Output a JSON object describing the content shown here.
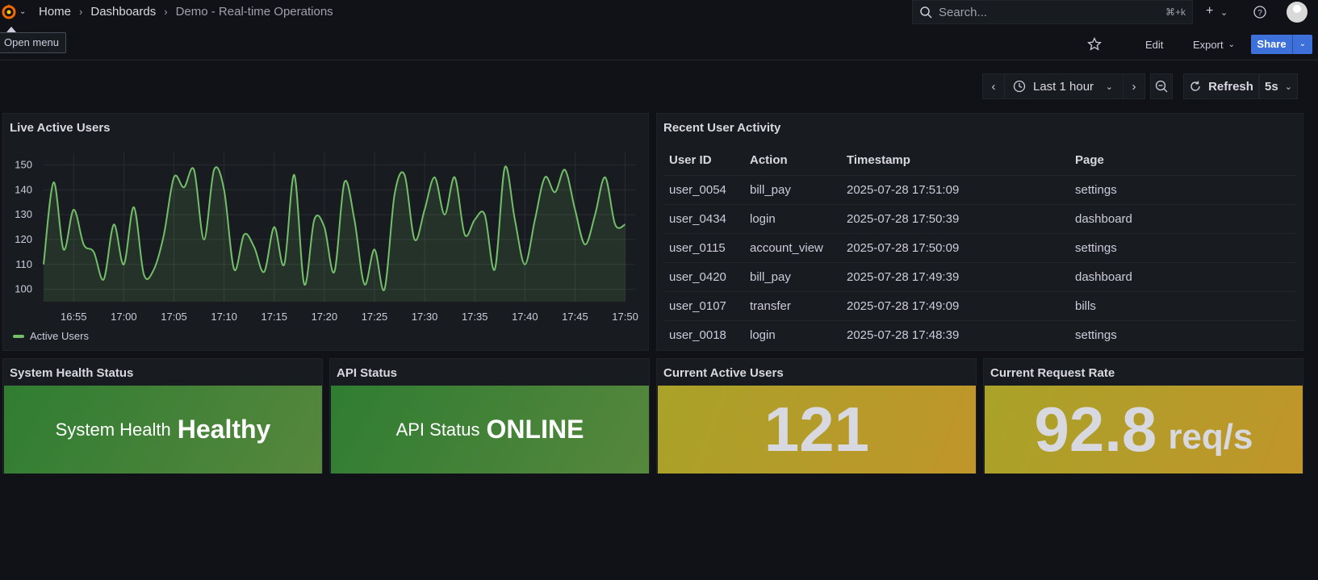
{
  "topbar": {
    "breadcrumbs": [
      "Home",
      "Dashboards",
      "Demo - Real-time Operations"
    ],
    "search_placeholder": "Search...",
    "search_shortcut": "⌘+k",
    "tooltip": "Open menu"
  },
  "toolbar": {
    "edit_label": "Edit",
    "export_label": "Export",
    "share_label": "Share"
  },
  "timepicker": {
    "range_label": "Last 1 hour",
    "refresh_label": "Refresh",
    "interval_label": "5s"
  },
  "panels": {
    "live_users": {
      "title": "Live Active Users",
      "legend": "Active Users"
    },
    "activity": {
      "title": "Recent User Activity",
      "columns": [
        "User ID",
        "Action",
        "Timestamp",
        "Page"
      ],
      "rows": [
        [
          "user_0054",
          "bill_pay",
          "2025-07-28 17:51:09",
          "settings"
        ],
        [
          "user_0434",
          "login",
          "2025-07-28 17:50:39",
          "dashboard"
        ],
        [
          "user_0115",
          "account_view",
          "2025-07-28 17:50:09",
          "settings"
        ],
        [
          "user_0420",
          "bill_pay",
          "2025-07-28 17:49:39",
          "dashboard"
        ],
        [
          "user_0107",
          "transfer",
          "2025-07-28 17:49:09",
          "bills"
        ],
        [
          "user_0018",
          "login",
          "2025-07-28 17:48:39",
          "settings"
        ]
      ]
    },
    "system_health": {
      "title": "System Health Status",
      "label": "System Health",
      "value": "Healthy"
    },
    "api_status": {
      "title": "API Status",
      "label": "API Status",
      "value": "ONLINE"
    },
    "current_users": {
      "title": "Current Active Users",
      "value": "121"
    },
    "request_rate": {
      "title": "Current Request Rate",
      "value": "92.8",
      "unit": "req/s"
    }
  },
  "colors": {
    "series": "#73bf69",
    "green_panel": "#3f8f3a",
    "yellow_panel": "#b8a32a",
    "share": "#3d71d9"
  },
  "chart_data": {
    "type": "line",
    "title": "Live Active Users",
    "x_ticks": [
      "16:55",
      "17:00",
      "17:05",
      "17:10",
      "17:15",
      "17:20",
      "17:25",
      "17:30",
      "17:35",
      "17:40",
      "17:45",
      "17:50"
    ],
    "y_ticks": [
      100,
      110,
      120,
      130,
      140,
      150
    ],
    "ylim": [
      95,
      155
    ],
    "xlim_minutes": [
      -58,
      1
    ],
    "series": [
      {
        "name": "Active Users",
        "x_minutes": [
          -58,
          -57,
          -56,
          -55,
          -54,
          -53,
          -52,
          -51,
          -50,
          -49,
          -48,
          -47,
          -46,
          -45,
          -44,
          -43,
          -42,
          -41,
          -40,
          -39,
          -38,
          -37,
          -36,
          -35,
          -34,
          -33,
          -32,
          -31,
          -30,
          -29,
          -28,
          -27,
          -26,
          -25,
          -24,
          -23,
          -22,
          -21,
          -20,
          -19,
          -18,
          -17,
          -16,
          -15,
          -14,
          -13,
          -12,
          -11,
          -10,
          -9,
          -8,
          -7,
          -6,
          -5,
          -4,
          -3,
          -2,
          -1,
          0
        ],
        "values": [
          110,
          143,
          116,
          132,
          118,
          115,
          104,
          126,
          110,
          133,
          106,
          108,
          122,
          145,
          141,
          148,
          120,
          148,
          140,
          108,
          122,
          117,
          107,
          125,
          110,
          146,
          102,
          128,
          125,
          107,
          143,
          128,
          102,
          116,
          100,
          138,
          146,
          120,
          132,
          145,
          130,
          145,
          122,
          128,
          130,
          108,
          149,
          128,
          110,
          128,
          145,
          139,
          148,
          132,
          118,
          130,
          145,
          126,
          126
        ]
      }
    ]
  }
}
